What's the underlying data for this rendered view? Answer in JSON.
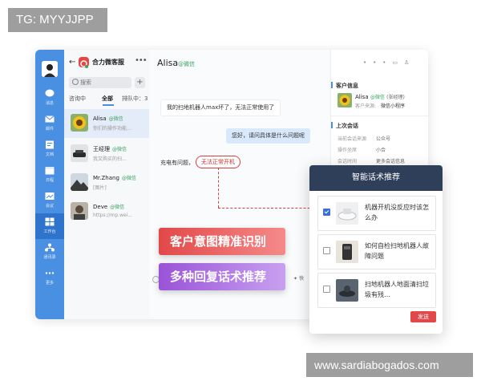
{
  "watermarks": {
    "top": "TG: MYYJJPP",
    "bottom": "www.sardiabogados.com"
  },
  "nav": {
    "items": [
      {
        "label": "消息",
        "icon": "chat-bubble-icon"
      },
      {
        "label": "邮件",
        "icon": "mail-icon"
      },
      {
        "label": "文档",
        "icon": "document-icon"
      },
      {
        "label": "日程",
        "icon": "calendar-icon"
      },
      {
        "label": "会议",
        "icon": "meeting-icon"
      },
      {
        "label": "工作台",
        "icon": "workbench-icon",
        "active": true
      },
      {
        "label": "通讯录",
        "icon": "contacts-icon"
      },
      {
        "label": "更多",
        "icon": "more-icon"
      }
    ]
  },
  "list": {
    "app_name": "合力微客服",
    "search_placeholder": "搜索",
    "tabs": [
      "咨询中",
      "全部",
      "排队中：3"
    ],
    "contacts": [
      {
        "name": "Alisa",
        "tag": "@微信",
        "preview": "你们的操作功能…"
      },
      {
        "name": "王经理",
        "tag": "@微信",
        "preview": "我又购买的扫…"
      },
      {
        "name": "Mr.Zhang",
        "tag": "@微信",
        "preview": "[图片]"
      },
      {
        "name": "Deve",
        "tag": "@微信",
        "preview": "https://mp.wei..."
      }
    ]
  },
  "chat": {
    "title": "Alisa",
    "title_tag": "@微信",
    "messages": [
      {
        "dir": "in",
        "text": "我的扫地机器人max坏了，无法正常使用了"
      },
      {
        "dir": "out",
        "text": "您好，请问具体是什么问题呢"
      },
      {
        "dir": "in",
        "text": "充电有问题，",
        "highlight": "无法正常开机"
      }
    ],
    "send_hint": "快"
  },
  "banners": [
    "客户意图精准识别",
    "多种回复话术推荐"
  ],
  "info": {
    "customer_section": "客户信息",
    "customer_name": "Alisa",
    "customer_tag": "@微信",
    "customer_note": "(张经理)",
    "source_label": "客户来源:",
    "source_value": "微信小程序",
    "last_session_section": "上次会话",
    "fields": [
      {
        "k": "当前会话来源",
        "v": "公众号"
      },
      {
        "k": "操作坐席",
        "v": "小合"
      },
      {
        "k": "会话时间",
        "v": "更多会话信息"
      }
    ]
  },
  "popup": {
    "title": "智能话术推荐",
    "suggestions": [
      {
        "text": "机器开机没反应时该怎么办",
        "checked": true
      },
      {
        "text": "如何自检扫地机器人故障问题",
        "checked": false
      },
      {
        "text": "扫地机器人地面清扫垃圾有残…",
        "checked": false
      }
    ],
    "send_label": "发送"
  },
  "colors": {
    "nav": "#4a90e2",
    "accent_red": "#e24848",
    "accent_purple": "#9a53d8",
    "popup_header": "#2f3f5a",
    "wechat_green": "#3aa360"
  }
}
